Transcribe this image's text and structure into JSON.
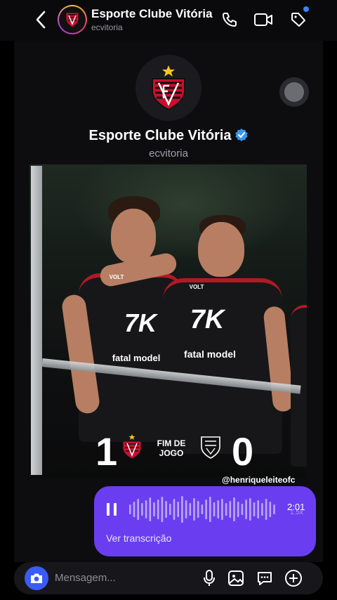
{
  "header": {
    "title": "Esporte Clube Vitória",
    "handle": "ecvitoria",
    "icons": [
      "back-icon",
      "phone-icon",
      "video-icon",
      "tag-icon"
    ]
  },
  "profile": {
    "name": "Esporte Clube Vitória",
    "handle": "ecvitoria",
    "verified": true
  },
  "post": {
    "score_home": "1",
    "score_away": "0",
    "status": "FIM DE JOGO",
    "watermark": "@henriqueleiteofc",
    "sponsor_main": "7K",
    "sponsor_secondary": "fatal model",
    "sponsor_small": "VOLT"
  },
  "voice_message": {
    "duration": "2:01",
    "speed": "1.5x",
    "transcribe_label": "Ver transcrição",
    "color": "#6a3ef0"
  },
  "composer": {
    "placeholder": "Mensagem...",
    "icons": [
      "camera-icon",
      "microphone-icon",
      "gallery-icon",
      "sticker-icon",
      "plus-icon"
    ]
  }
}
